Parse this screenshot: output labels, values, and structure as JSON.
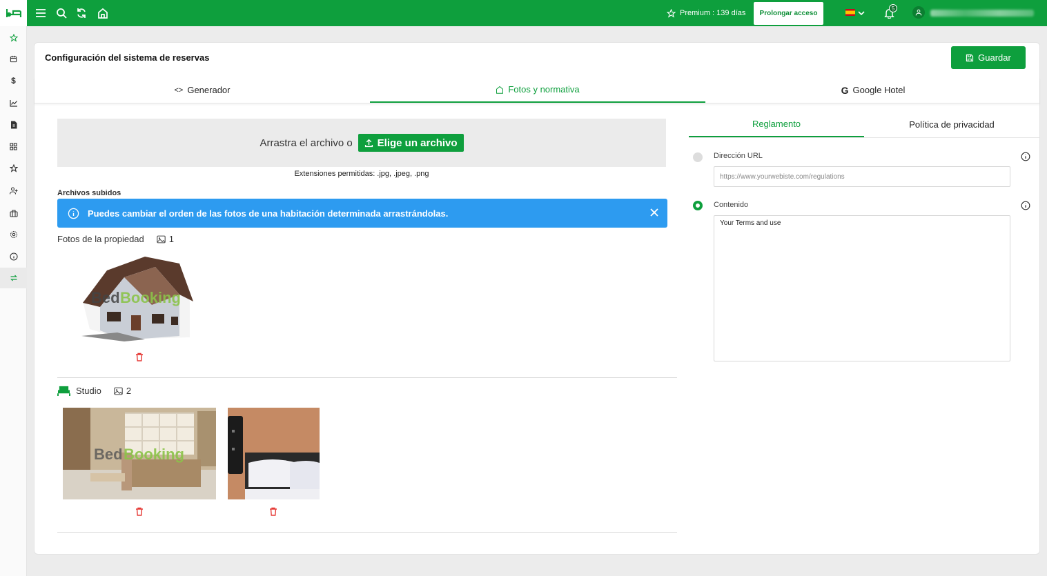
{
  "topbar": {
    "premium_label": "Premium : 139 días",
    "prolong_button": "Prolongar acceso",
    "notifications_count": "5",
    "language": "es",
    "colors": {
      "brand": "#0e9f3d",
      "alert": "#2d9bf0"
    }
  },
  "sidebar": {
    "items": [
      "bed-logo-icon",
      "star-icon",
      "calendar-icon",
      "dollar-icon",
      "chart-icon",
      "document-icon",
      "grid-icon",
      "star-outline-icon",
      "user-plus-icon",
      "briefcase-icon",
      "gear-icon",
      "info-icon",
      "sync-icon"
    ]
  },
  "page": {
    "title": "Configuración del sistema de reservas",
    "save_button": "Guardar",
    "tabs": [
      {
        "label": "Generador",
        "icon": "code-icon"
      },
      {
        "label": "Fotos y normativa",
        "icon": "home-icon"
      },
      {
        "label": "Google Hotel",
        "icon": "google-icon"
      }
    ],
    "active_tab": "Fotos y normativa"
  },
  "upload": {
    "drag_text": "Arrastra el archivo o",
    "choose_button": "Elige un archivo",
    "extensions": "Extensiones permitidas: .jpg, .jpeg, .png",
    "uploaded_label": "Archivos subidos"
  },
  "alert": {
    "message": "Puedes cambiar el orden de las fotos de una habitación determinada arrastrándolas."
  },
  "property_photos": {
    "label": "Fotos de la propiedad",
    "count": "1",
    "watermark_bed": "Bed",
    "watermark_booking": "Booking"
  },
  "studio": {
    "label": "Studio",
    "count": "2",
    "watermark_bed": "Bed",
    "watermark_booking": "Booking"
  },
  "rules": {
    "tabs": [
      "Reglamento",
      "Política de privacidad"
    ],
    "active_tab": "Reglamento",
    "url_label": "Dirección URL",
    "url_placeholder": "https://www.yourwebiste.com/regulations",
    "content_label": "Contenido",
    "content_value": "Your Terms and use",
    "selected_option": "Contenido"
  }
}
